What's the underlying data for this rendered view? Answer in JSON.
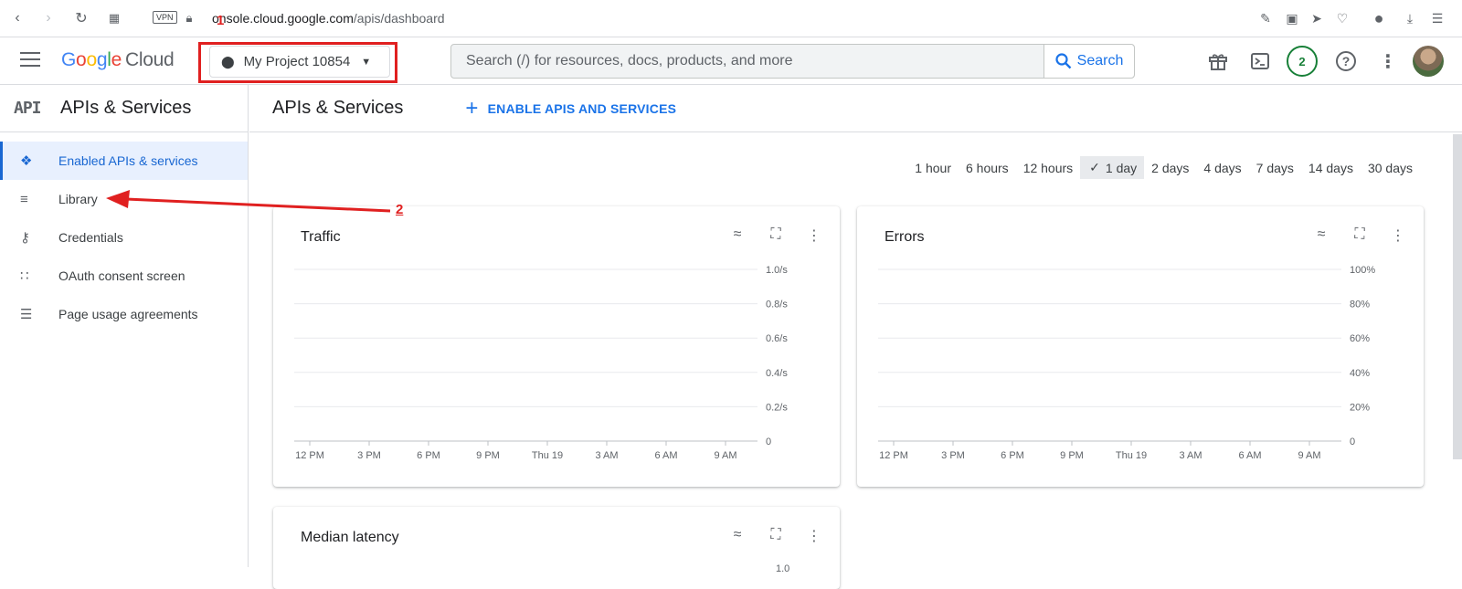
{
  "browser": {
    "vpn_label": "VPN",
    "url_prefix": "",
    "url_domain": "onsole.cloud.google.com",
    "url_path": "/apis/dashboard"
  },
  "annotations": {
    "one": "1",
    "two": "2"
  },
  "header": {
    "logo_google": "Google",
    "logo_cloud": "Cloud",
    "project_name": "My Project 10854",
    "search_placeholder": "Search (/) for resources, docs, products, and more",
    "search_button": "Search",
    "notification_count": "2"
  },
  "sidebar": {
    "logo_text": "API",
    "title": "APIs & Services",
    "items": [
      {
        "label": "Enabled APIs & services",
        "icon": "diamond-dots-icon",
        "active": true
      },
      {
        "label": "Library",
        "icon": "library-icon",
        "active": false
      },
      {
        "label": "Credentials",
        "icon": "key-icon",
        "active": false
      },
      {
        "label": "OAuth consent screen",
        "icon": "consent-icon",
        "active": false
      },
      {
        "label": "Page usage agreements",
        "icon": "settings-list-icon",
        "active": false
      }
    ]
  },
  "main": {
    "title": "APIs & Services",
    "enable_button": "ENABLE APIS AND SERVICES",
    "time_options": [
      "1 hour",
      "6 hours",
      "12 hours",
      "1 day",
      "2 days",
      "4 days",
      "7 days",
      "14 days",
      "30 days"
    ],
    "selected_time": "1 day"
  },
  "charts": {
    "x_ticks": [
      "12 PM",
      "3 PM",
      "6 PM",
      "9 PM",
      "Thu 19",
      "3 AM",
      "6 AM",
      "9 AM"
    ],
    "traffic": {
      "title": "Traffic",
      "y_ticks": [
        "1.0/s",
        "0.8/s",
        "0.6/s",
        "0.4/s",
        "0.2/s",
        "0"
      ]
    },
    "errors": {
      "title": "Errors",
      "y_ticks": [
        "100%",
        "80%",
        "60%",
        "40%",
        "20%",
        "0"
      ]
    },
    "latency": {
      "title": "Median latency",
      "y_ticks": [
        "1.0"
      ]
    }
  },
  "colors": {
    "accent": "#1a73e8",
    "annotation": "#e02020",
    "active_bg": "#e8f0fe"
  }
}
